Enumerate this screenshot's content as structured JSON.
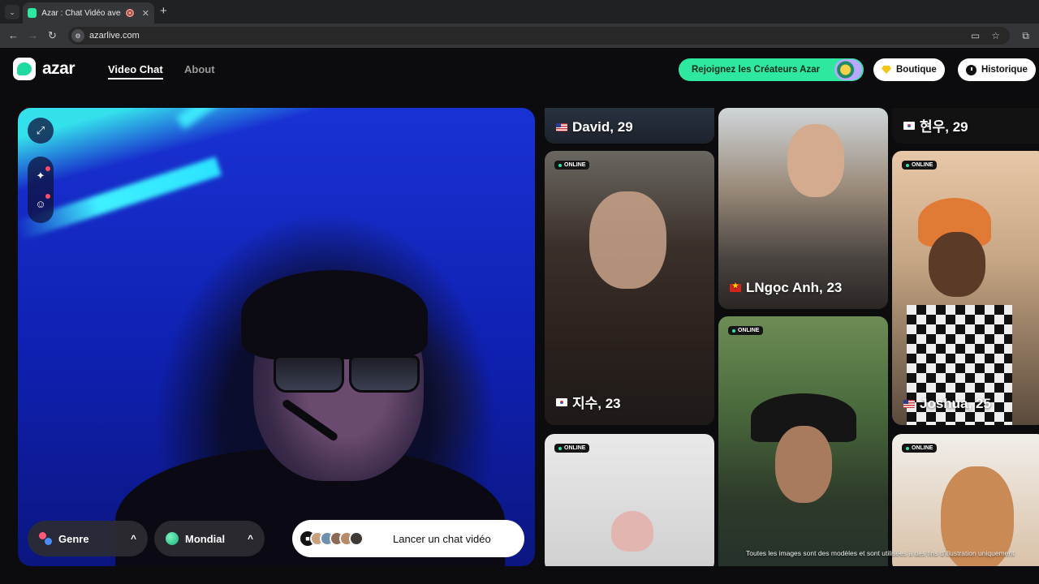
{
  "browser": {
    "tab_title": "Azar : Chat Vidéo avec de n",
    "tab_close": "✕",
    "new_tab": "+",
    "url": "azarlive.com"
  },
  "header": {
    "logo_text": "azar",
    "nav": {
      "video_chat": "Video Chat",
      "about": "About"
    },
    "creators_label": "Rejoignez les Créateurs Azar",
    "boutique_label": "Boutique",
    "historique_label": "Historique"
  },
  "video": {
    "genre_label": "Genre",
    "region_label": "Mondial",
    "launch_label": "Lancer un chat vidéo",
    "chevron": "^"
  },
  "profiles": [
    {
      "name": "David, 29",
      "flag": "us",
      "online": false
    },
    {
      "name": "현우, 29",
      "flag": "kr",
      "online": false
    },
    {
      "name": "지수, 23",
      "flag": "kr",
      "online": true
    },
    {
      "name": "LNgọc Anh, 23",
      "flag": "vn",
      "online": false
    },
    {
      "name": "Joshua, 25",
      "flag": "us",
      "online": true
    },
    {
      "name": "",
      "flag": "",
      "online": true
    },
    {
      "name": "",
      "flag": "",
      "online": true
    },
    {
      "name": "",
      "flag": "",
      "online": true
    }
  ],
  "online_label": "ONLINE",
  "disclaimer": "Toutes les images sont des modèles et sont utilisées à des fins d'illustration uniquement",
  "colors": {
    "accent": "#2ee8a0",
    "background": "#0c0c0e",
    "video_blue": "#1932d4",
    "neon": "#3ff0ff"
  }
}
